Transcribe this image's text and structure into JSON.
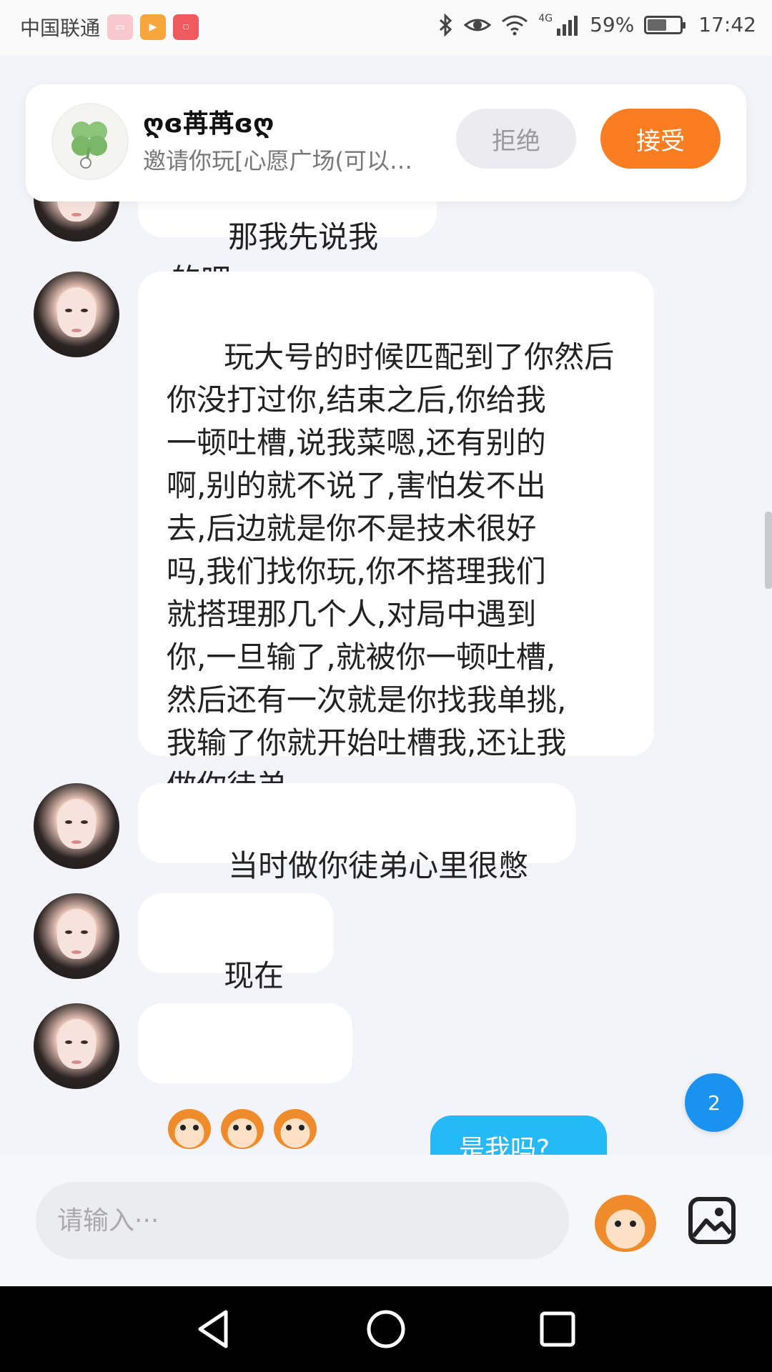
{
  "status_bar": {
    "carrier": "中国联通",
    "battery": "59%",
    "battery_level": 0.59,
    "signal": "4G",
    "time": "17:42"
  },
  "invite": {
    "name": "ღɞ苒苒ɞღ",
    "subtitle": "邀请你玩[心愿广场(可以…",
    "reject_label": "拒绝",
    "accept_label": "接受"
  },
  "messages": [
    {
      "text": "那我先说我的吧"
    },
    {
      "text": "玩大号的时候匹配到了你然后\n你没打过你,结束之后,你给我\n一顿吐槽,说我菜嗯,还有别的\n啊,别的就不说了,害怕发不出\n去,后边就是你不是技术很好\n吗,我们找你玩,你不搭理我们\n就搭理那几个人,对局中遇到\n你,一旦输了,就被你一顿吐槽,\n然后还有一次就是你找我单挑,\n我输了你就开始吐槽我,还让我\n做你徒弟"
    },
    {
      "text": "当时做你徒弟心里很憋屈"
    },
    {
      "text": "现在不了"
    },
    {
      "emojis": [
        "monkey-icon",
        "monkey-icon",
        "monkey-icon"
      ]
    }
  ],
  "sent": {
    "text": "是我吗?"
  },
  "unread_badge": "2",
  "input": {
    "placeholder": "请输入···"
  },
  "colors": {
    "accent_orange": "#fa7d22",
    "sent_blue": "#26b9f7",
    "badge_blue": "#1a93f0",
    "chat_bg": "#f2f4fa"
  }
}
